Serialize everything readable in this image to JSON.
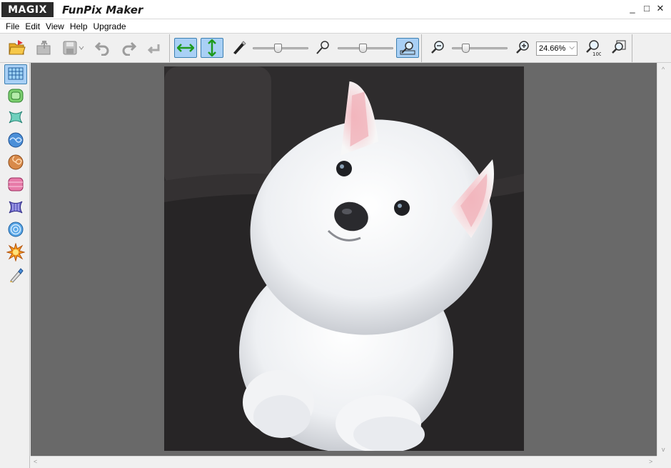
{
  "titlebar": {
    "brand": "MAGIX",
    "app_title": "FunPix Maker",
    "minimize": "_",
    "maximize": "□",
    "close": "✕"
  },
  "menu": {
    "items": [
      "File",
      "Edit",
      "View",
      "Help",
      "Upgrade"
    ]
  },
  "toolbar": {
    "zoom_value": "24.66%",
    "zoom_chevron": "⌵",
    "slider_width_level": 0.45,
    "slider_depth_level": 0.45,
    "slider_zoom_level": 0.2
  },
  "scroll": {
    "up": "^",
    "down": "v",
    "left": "<",
    "right": ">"
  },
  "colors": {
    "accent": "#a9d0f5",
    "accent_border": "#3c7fb1",
    "canvas_bg": "#696969",
    "green_arrow": "#2fa82f"
  }
}
